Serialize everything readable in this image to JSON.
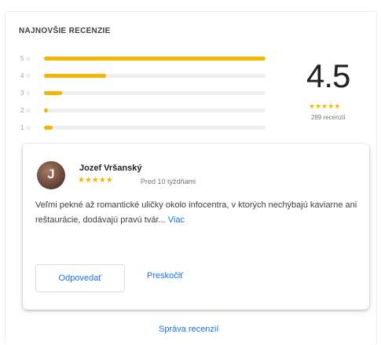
{
  "section_title": "NAJNOVŠIE RECENZIE",
  "rating_bars": [
    {
      "label": "5 ☆",
      "fraction": 1.0
    },
    {
      "label": "4 ☆",
      "fraction": 0.28
    },
    {
      "label": "3 ☆",
      "fraction": 0.08
    },
    {
      "label": "2 ☆",
      "fraction": 0.015
    },
    {
      "label": "1 ☆",
      "fraction": 0.04
    }
  ],
  "summary": {
    "score": "4.5",
    "stars": "★★★★★",
    "count": "289 recenzií"
  },
  "review": {
    "avatar_letter": "J",
    "name": "Jozef Vršanský",
    "stars": "★★★★★",
    "date": "Pred 10 týždňami",
    "text": "Veľmi pekné až romantické uličky okolo infocentra, v ktorých nechýbajú kaviarne ani reštaurácie, dodávajú pravú tvár...",
    "more_label": "Viac",
    "reply_label": "Odpovedať",
    "skip_label": "Preskočiť"
  },
  "footer": {
    "manage_label": "Správa recenzií"
  },
  "colors": {
    "star": "#f4b400",
    "link": "#1a73e8",
    "track": "#eeeeee"
  }
}
